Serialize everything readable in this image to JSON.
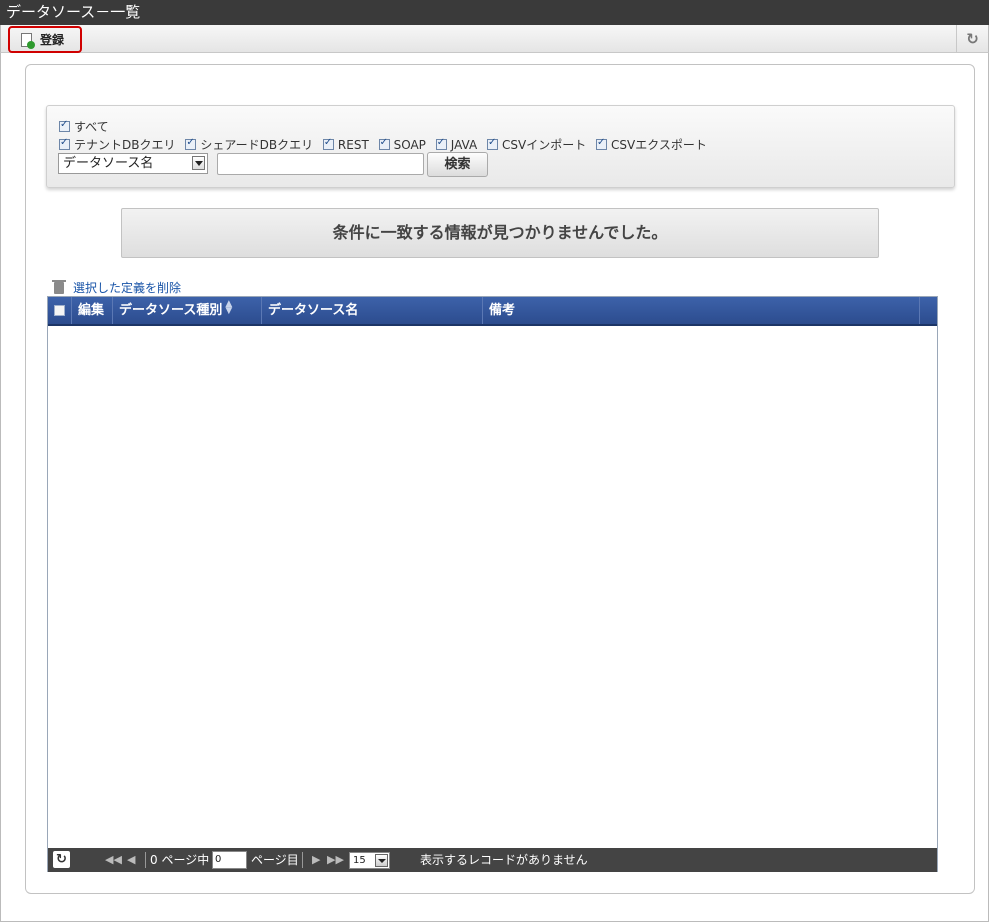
{
  "window": {
    "title": "データソース－一覧"
  },
  "toolbar": {
    "register_label": "登録",
    "reload_icon": "reload-icon"
  },
  "filter": {
    "all_label": "すべて",
    "types": [
      "テナントDBクエリ",
      "シェアードDBクエリ",
      "REST",
      "SOAP",
      "JAVA",
      "CSVインポート",
      "CSVエクスポート"
    ],
    "field_select": "データソース名",
    "search_value": "",
    "search_button": "検索"
  },
  "notice": {
    "message": "条件に一致する情報が見つかりませんでした。"
  },
  "actions": {
    "delete_selected": "選択した定義を削除"
  },
  "grid": {
    "columns": [
      "編集",
      "データソース種別",
      "データソース名",
      "備考"
    ],
    "rows": []
  },
  "pager": {
    "total_pages_text": "0 ページ中",
    "current_page": "0",
    "page_suffix": "ページ目",
    "page_size": "15",
    "status": "表示するレコードがありません"
  }
}
